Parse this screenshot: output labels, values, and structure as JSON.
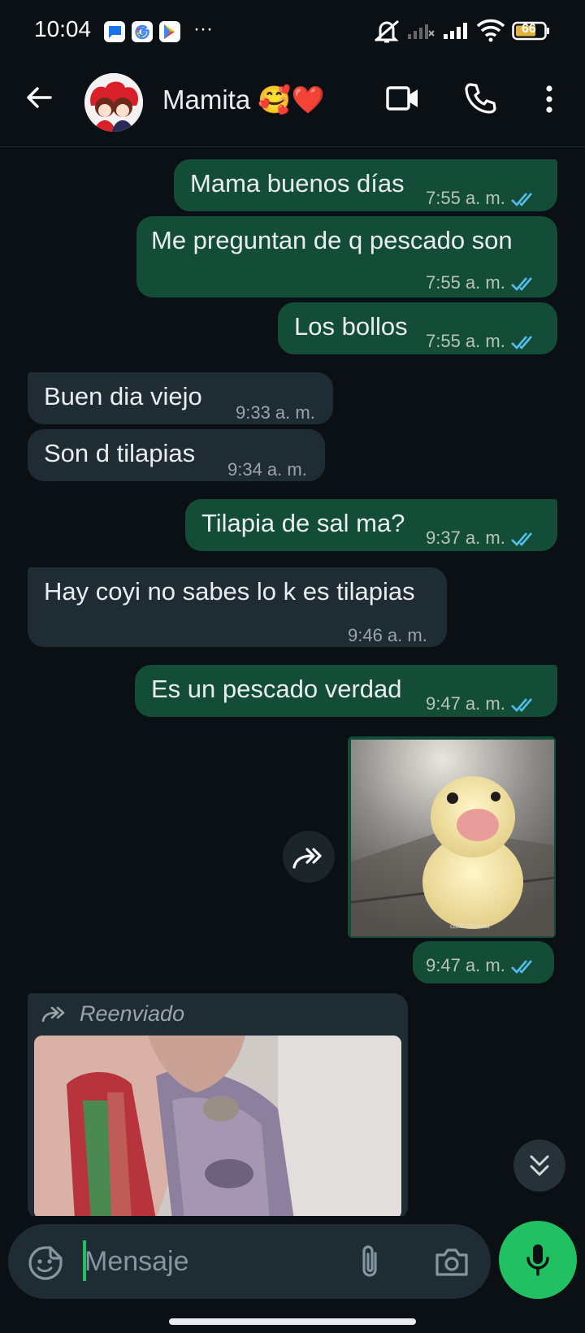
{
  "status_bar": {
    "time": "10:04",
    "more": "···",
    "battery": "66",
    "icons": [
      "messages-icon",
      "google-icon",
      "play-store-icon",
      "mute-icon",
      "signal-icon",
      "signal-icon",
      "wifi-icon",
      "battery-icon"
    ]
  },
  "header": {
    "contact_name": "Mamita 🥰❤️",
    "icons": [
      "back-arrow-icon",
      "video-call-icon",
      "phone-icon",
      "more-vert-icon"
    ]
  },
  "messages": [
    {
      "dir": "out",
      "text": "Mama buenos días",
      "time": "7:55 a. m."
    },
    {
      "dir": "out",
      "text": "Me preguntan de q pescado son",
      "time": "7:55 a. m."
    },
    {
      "dir": "out",
      "text": "Los bollos",
      "time": "7:55 a. m."
    },
    {
      "dir": "in",
      "text": "Buen dia viejo",
      "time": "9:33 a. m."
    },
    {
      "dir": "in",
      "text": "Son d tilapias",
      "time": "9:34 a. m."
    },
    {
      "dir": "out",
      "text": "Tilapia de sal ma?",
      "time": "9:37 a. m."
    },
    {
      "dir": "in",
      "text": "Hay coyi no sabes lo k es tilapias",
      "time": "9:46 a. m."
    },
    {
      "dir": "out",
      "text": "Es un pescado verdad",
      "time": "9:47 a. m."
    }
  ],
  "image_message": {
    "time": "9:47 a. m.",
    "watermark": "callducksfrost"
  },
  "forwarded": {
    "label": "Reenviado"
  },
  "composer": {
    "placeholder": "Mensaje"
  },
  "colors": {
    "outgoing": "#144d37",
    "incoming": "#1f2c33",
    "accent": "#21c063",
    "read_ticks": "#53bdeb",
    "background": "#0b1014"
  }
}
